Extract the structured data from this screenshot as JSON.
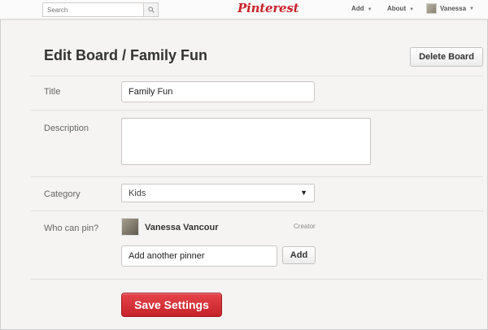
{
  "header": {
    "search_placeholder": "Search",
    "logo": "Pinterest",
    "nav": [
      {
        "label": "Add"
      },
      {
        "label": "About"
      }
    ],
    "user_name": "Vanessa"
  },
  "main": {
    "page_title": "Edit Board / Family Fun",
    "delete_label": "Delete Board",
    "fields": {
      "title_label": "Title",
      "title_value": "Family Fun",
      "description_label": "Description",
      "description_value": "",
      "category_label": "Category",
      "category_value": "Kids",
      "pin_label": "Who can pin?"
    },
    "pinners": [
      {
        "name": "Vanessa Vancour",
        "role": "Creator"
      }
    ],
    "add_pinner_value": "Add another pinner",
    "add_label": "Add",
    "save_label": "Save Settings"
  },
  "colors": {
    "brand": "#c8232c",
    "save_button": "#d9333a"
  }
}
